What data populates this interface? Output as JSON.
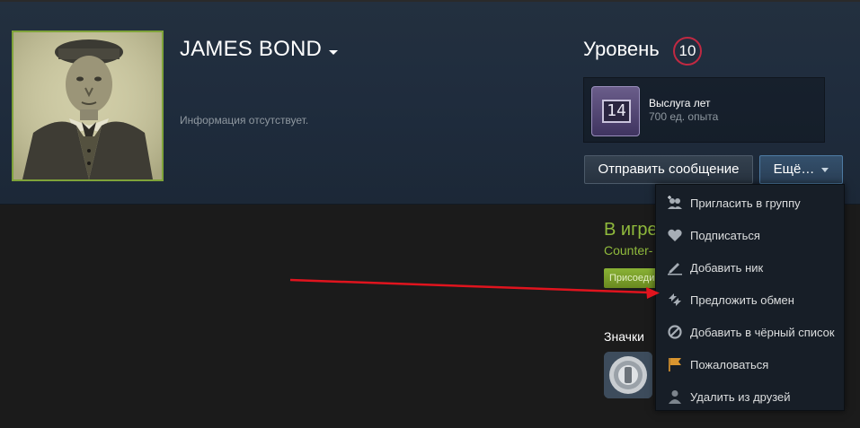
{
  "profile": {
    "persona_name": "JAMES BOND",
    "summary": "Информация отсутствует."
  },
  "level": {
    "title": "Уровень",
    "value": "10",
    "badge": {
      "number": "14",
      "name": "Выслуга лет",
      "xp": "700 ед. опыта"
    }
  },
  "actions": {
    "send_message": "Отправить сообщение",
    "more": "Ещё…"
  },
  "menu": {
    "items": [
      {
        "label": "Пригласить в группу",
        "icon": "group-invite-icon"
      },
      {
        "label": "Подписаться",
        "icon": "heart-icon"
      },
      {
        "label": "Добавить ник",
        "icon": "pencil-icon"
      },
      {
        "label": "Предложить обмен",
        "icon": "trade-icon"
      },
      {
        "label": "Добавить в чёрный список",
        "icon": "block-icon"
      },
      {
        "label": "Пожаловаться",
        "icon": "flag-icon"
      },
      {
        "label": "Удалить из друзей",
        "icon": "remove-friend-icon"
      }
    ]
  },
  "status": {
    "in_game": "В игре",
    "game": "Counter-",
    "join": "Присоеди"
  },
  "badges": {
    "label": "Значки"
  },
  "colors": {
    "accent_green": "#90ba3c",
    "level_ring": "#c02942",
    "arrow": "#e0141e"
  }
}
